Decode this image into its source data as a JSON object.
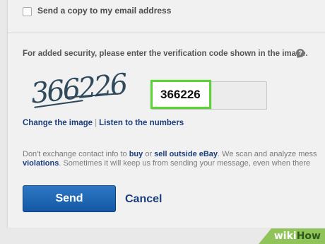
{
  "form": {
    "copy_label": "Send a copy to my email address",
    "copy_checked": false,
    "security_text": "For added security, please enter the verification code shown in the image.",
    "help_glyph": "?",
    "captcha_code": "366226",
    "entered_code": "366226",
    "change_image_link": "Change the image",
    "link_separator": "|",
    "listen_link": "Listen to the numbers",
    "notice_part1": "Don't exchange contact info to ",
    "notice_link1": "buy",
    "notice_part2": " or ",
    "notice_link2": "sell outside eBay",
    "notice_part3": ". We scan and analyze mess",
    "notice_link3": "violations",
    "notice_part4": ". Sometimes it will keep us from sending your message, even when there",
    "send_label": "Send",
    "cancel_label": "Cancel"
  },
  "watermark": {
    "part1": "wiki",
    "part2": "How"
  },
  "colors": {
    "highlight_border": "#5bd534",
    "button_blue": "#1558a5",
    "link_blue": "#1c3e7a",
    "watermark_green": "#90c45a"
  }
}
